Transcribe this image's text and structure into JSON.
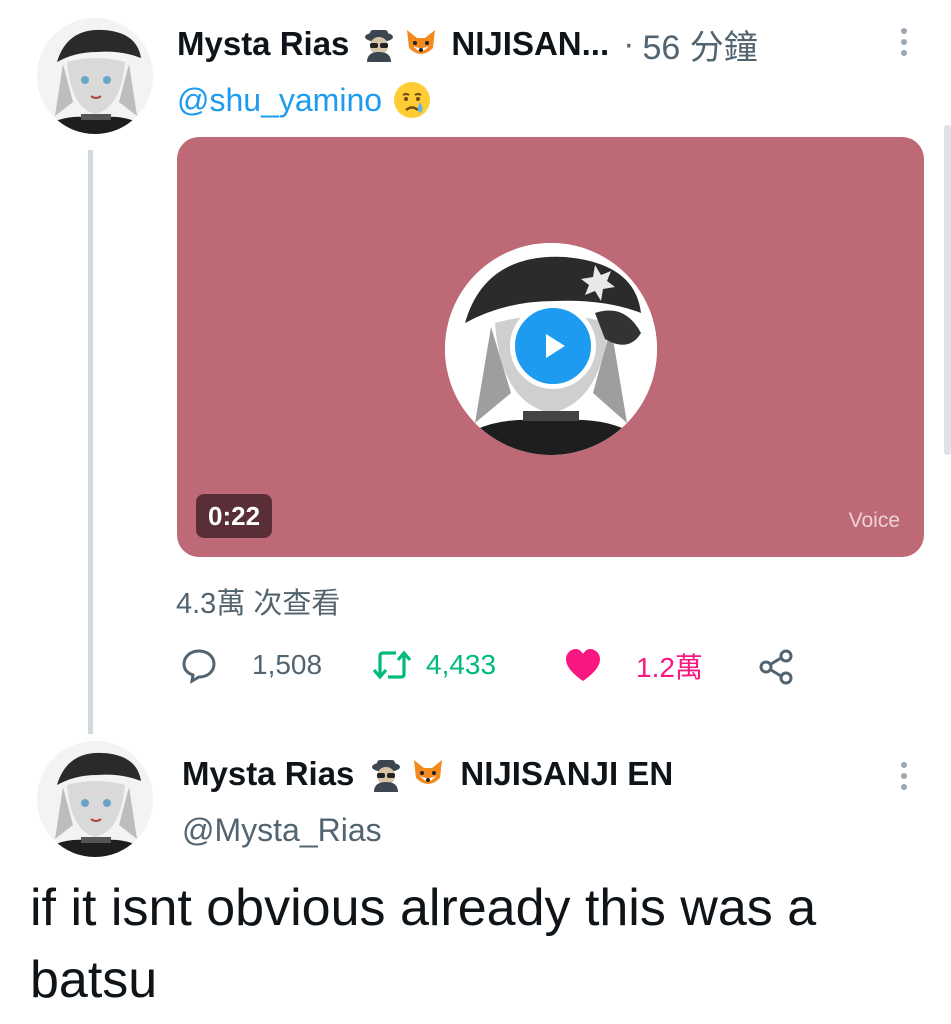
{
  "tweet1": {
    "display_name": "Mysta Rias",
    "emoji_1": "detective-emoji",
    "emoji_2": "fox-emoji",
    "group_name": "NIJISAN...",
    "separator": "·",
    "time_ago": "56 分鐘",
    "handle": "@shu_yamino",
    "handle_emoji": "crying-face-emoji",
    "media": {
      "duration": "0:22",
      "badge": "Voice",
      "background_color": "#be6a76",
      "play_icon": "play-icon"
    },
    "views": "4.3萬 次查看",
    "actions": {
      "reply_count": "1,508",
      "retweet_count": "4,433",
      "like_count": "1.2萬"
    },
    "colors": {
      "retweet": "#00ba7c",
      "like": "#f91880",
      "link": "#1d9bf0"
    }
  },
  "tweet2": {
    "display_name": "Mysta Rias",
    "emoji_1": "detective-emoji",
    "emoji_2": "fox-emoji",
    "group_name": "NIJISANJI EN",
    "handle": "@Mysta_Rias",
    "text": "if it isnt obvious already this was a batsu"
  }
}
